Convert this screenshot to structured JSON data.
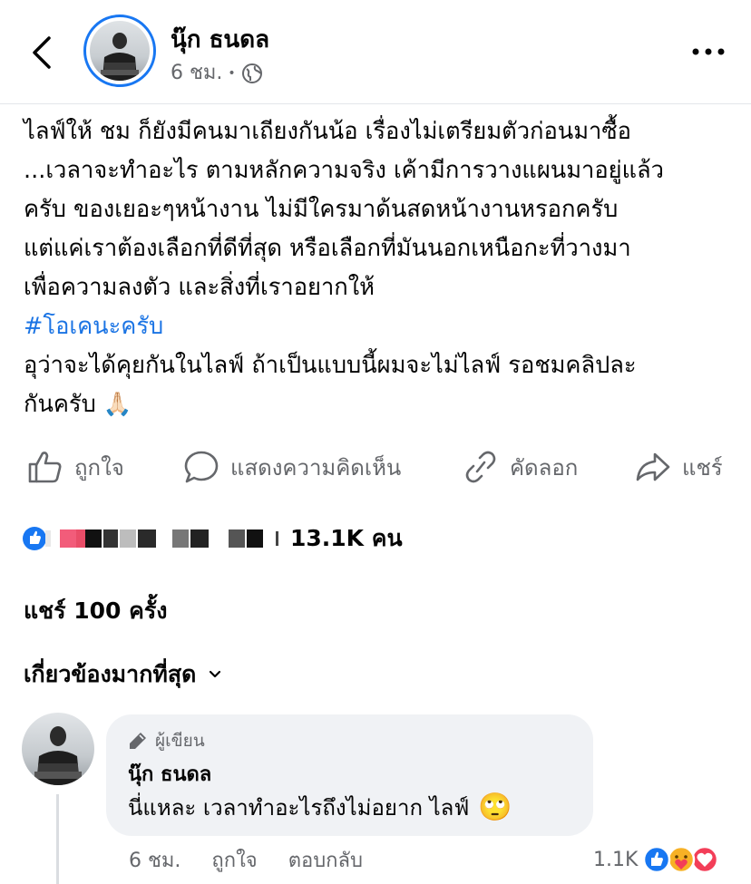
{
  "header": {
    "author_name": "นุ๊ก ธนดล",
    "time": "6 ชม.",
    "separator": "•",
    "audience_icon": "globe-icon"
  },
  "post": {
    "text_before": "ไลฟ์ให้ ชม ก็ยังมีคนมาเถียงกันน้อ เรื่องไม่เตรียมตัวก่อนมาซื้อ\n...เวลาจะทำอะไร ตามหลักความจริง เค้ามีการวางแผนมาอยู่แล้ว\nครับ ของเยอะๆหน้างาน ไม่มีใครมาด้นสดหน้างานหรอกครับ\nแต่แค่เราต้องเลือกที่ดีที่สุด หรือเลือกที่มันนอกเหนือกะที่วางมา\nเพื่อความลงตัว และสิ่งที่เราอยากให้\n",
    "hashtag": "#โอเคนะครับ",
    "text_after": "\nอุว่าจะได้คุยกันในไลฟ์ ถ้าเป็นแบบนี้ผมจะไม่ไลฟ์ รอชมคลิปละ\nกันครับ ",
    "emoji": "🙏🏻"
  },
  "actions": {
    "like": "ถูกใจ",
    "comment": "แสดงความคิดเห็น",
    "copy": "คัดลอก",
    "share": "แชร์"
  },
  "reactions": {
    "count": "13.1K คน"
  },
  "shares": {
    "text": "แชร์ 100 ครั้ง"
  },
  "filter": {
    "label": "เกี่ยวข้องมากที่สุด"
  },
  "comment": {
    "badge": "ผู้เขียน",
    "name": "นุ๊ก ธนดล",
    "text": "นี่แหละ เวลาทำอะไรถึงไม่อยาก ไลฟ์",
    "emoji": "🙄",
    "time": "6 ชม.",
    "like": "ถูกใจ",
    "reply": "ตอบกลับ",
    "reaction_count": "1.1K"
  },
  "colors": {
    "accent": "#1877f2",
    "hashtag": "#1b74e4",
    "muted": "#65676b",
    "bubble": "#f0f2f5",
    "love": "#f33e58",
    "care": "#f7b125"
  }
}
